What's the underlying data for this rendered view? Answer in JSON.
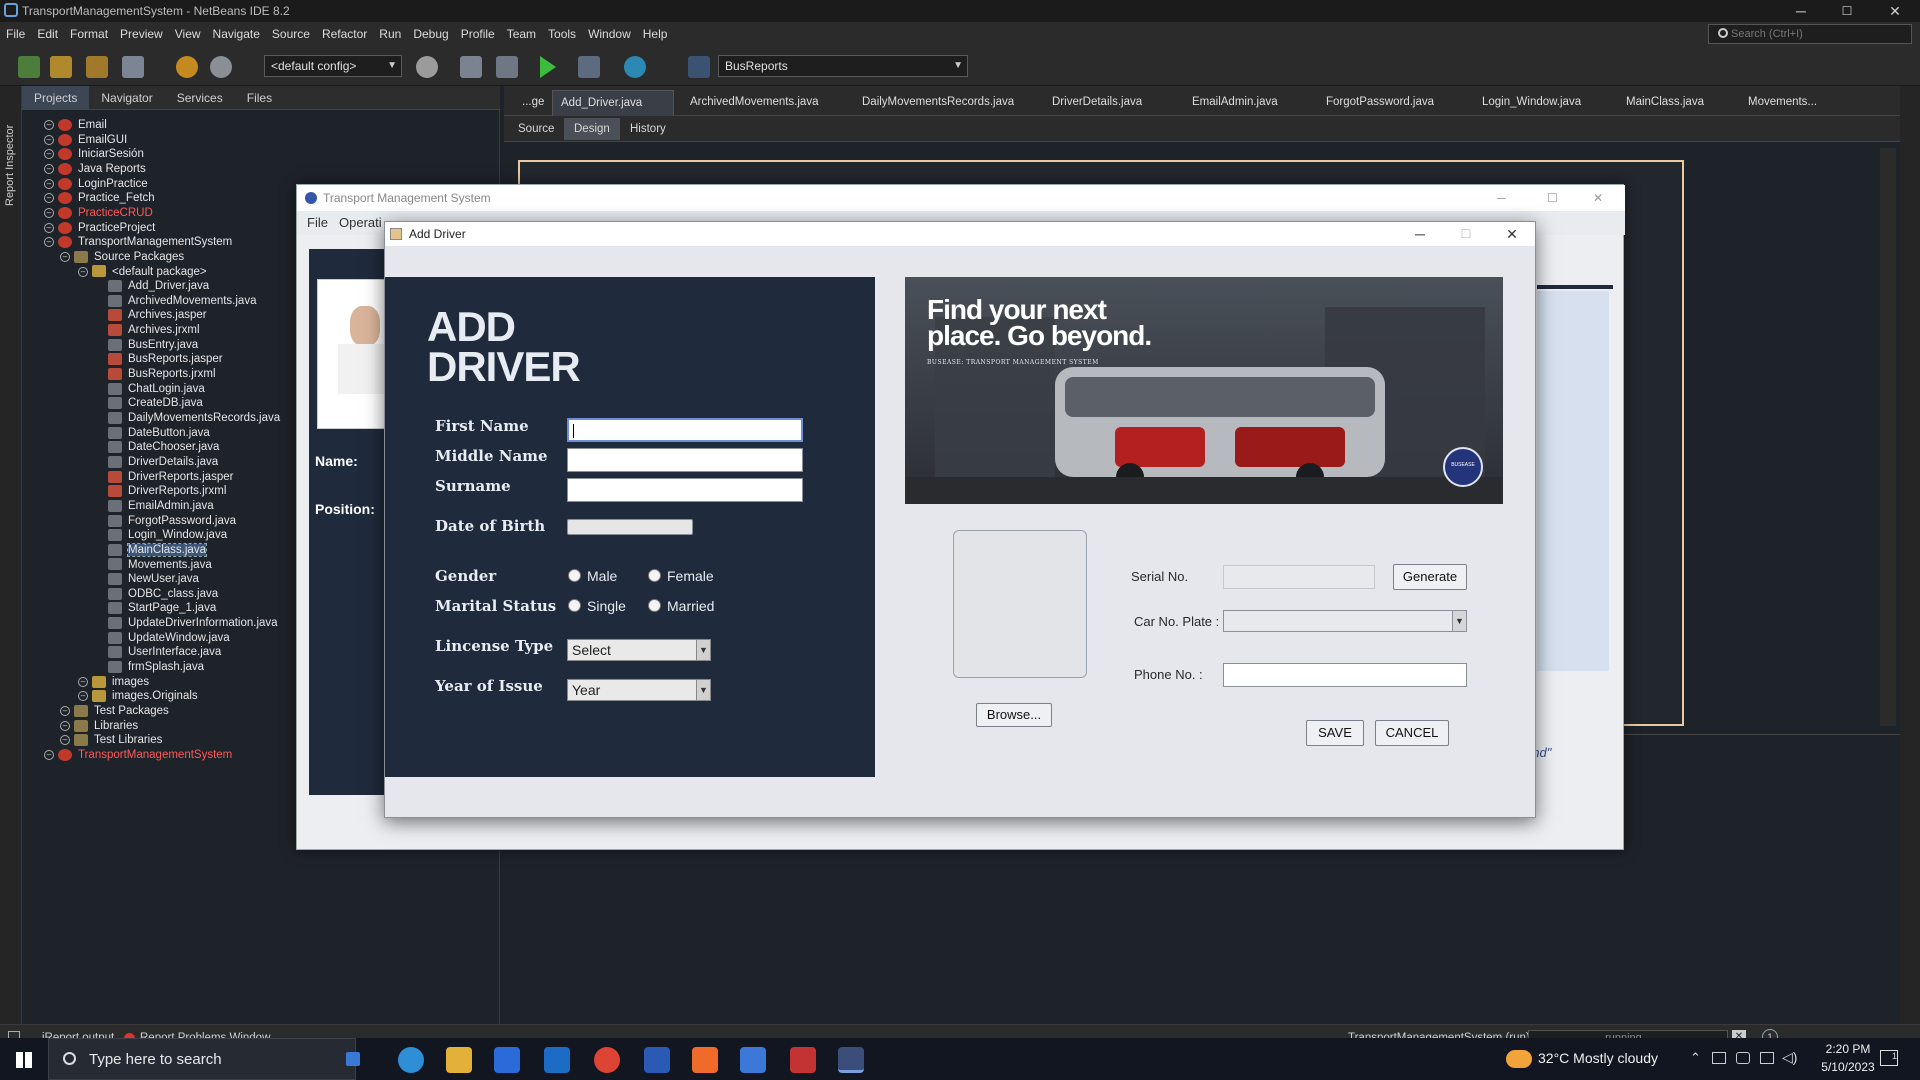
{
  "window": {
    "title": "TransportManagementSystem - NetBeans IDE 8.2",
    "minimize": "─",
    "maximize": "☐",
    "close": "✕"
  },
  "menu": [
    "File",
    "Edit",
    "Format",
    "Preview",
    "View",
    "Navigate",
    "Source",
    "Refactor",
    "Run",
    "Debug",
    "Profile",
    "Team",
    "Tools",
    "Window",
    "Help"
  ],
  "search_placeholder": "Search (Ctrl+I)",
  "toolbar": {
    "config": "<default config>",
    "report_combo": "BusReports"
  },
  "left_strip_label": "Report Inspector",
  "project_tabs": [
    "Projects",
    "Navigator",
    "Services",
    "Files"
  ],
  "tree": [
    {
      "label": "Email",
      "indent": 0,
      "type": "project",
      "red": false
    },
    {
      "label": "EmailGUI",
      "indent": 0,
      "type": "project",
      "red": false
    },
    {
      "label": "IniciarSesión",
      "indent": 0,
      "type": "project",
      "red": false
    },
    {
      "label": "Java Reports",
      "indent": 0,
      "type": "project",
      "red": false
    },
    {
      "label": "LoginPractice",
      "indent": 0,
      "type": "project",
      "red": false
    },
    {
      "label": "Practice_Fetch",
      "indent": 0,
      "type": "project",
      "red": false
    },
    {
      "label": "PracticeCRUD",
      "indent": 0,
      "type": "project",
      "red": true
    },
    {
      "label": "PracticeProject",
      "indent": 0,
      "type": "project",
      "red": false
    },
    {
      "label": "TransportManagementSystem",
      "indent": 0,
      "type": "project",
      "red": false
    },
    {
      "label": "Source Packages",
      "indent": 1,
      "type": "folder",
      "red": false
    },
    {
      "label": "<default package>",
      "indent": 2,
      "type": "package",
      "red": false
    },
    {
      "label": "Add_Driver.java",
      "indent": 3,
      "type": "java",
      "red": false
    },
    {
      "label": "ArchivedMovements.java",
      "indent": 3,
      "type": "java",
      "red": false
    },
    {
      "label": "Archives.jasper",
      "indent": 3,
      "type": "jasper",
      "red": false
    },
    {
      "label": "Archives.jrxml",
      "indent": 3,
      "type": "jrxml",
      "red": false
    },
    {
      "label": "BusEntry.java",
      "indent": 3,
      "type": "java",
      "red": false
    },
    {
      "label": "BusReports.jasper",
      "indent": 3,
      "type": "jasper",
      "red": false
    },
    {
      "label": "BusReports.jrxml",
      "indent": 3,
      "type": "jrxml",
      "red": false
    },
    {
      "label": "ChatLogin.java",
      "indent": 3,
      "type": "java",
      "red": false
    },
    {
      "label": "CreateDB.java",
      "indent": 3,
      "type": "java",
      "red": false
    },
    {
      "label": "DailyMovementsRecords.java",
      "indent": 3,
      "type": "java",
      "red": false
    },
    {
      "label": "DateButton.java",
      "indent": 3,
      "type": "java",
      "red": false
    },
    {
      "label": "DateChooser.java",
      "indent": 3,
      "type": "java",
      "red": false
    },
    {
      "label": "DriverDetails.java",
      "indent": 3,
      "type": "java",
      "red": false
    },
    {
      "label": "DriverReports.jasper",
      "indent": 3,
      "type": "jasper",
      "red": false
    },
    {
      "label": "DriverReports.jrxml",
      "indent": 3,
      "type": "jrxml",
      "red": false
    },
    {
      "label": "EmailAdmin.java",
      "indent": 3,
      "type": "java",
      "red": false
    },
    {
      "label": "ForgotPassword.java",
      "indent": 3,
      "type": "java",
      "red": false
    },
    {
      "label": "Login_Window.java",
      "indent": 3,
      "type": "java",
      "red": false
    },
    {
      "label": "MainClass.java",
      "indent": 3,
      "type": "java",
      "red": false,
      "selected": true
    },
    {
      "label": "Movements.java",
      "indent": 3,
      "type": "java",
      "red": false
    },
    {
      "label": "NewUser.java",
      "indent": 3,
      "type": "java",
      "red": false
    },
    {
      "label": "ODBC_class.java",
      "indent": 3,
      "type": "java",
      "red": false
    },
    {
      "label": "StartPage_1.java",
      "indent": 3,
      "type": "java",
      "red": false
    },
    {
      "label": "UpdateDriverInformation.java",
      "indent": 3,
      "type": "java",
      "red": false
    },
    {
      "label": "UpdateWindow.java",
      "indent": 3,
      "type": "java",
      "red": false
    },
    {
      "label": "UserInterface.java",
      "indent": 3,
      "type": "java",
      "red": false
    },
    {
      "label": "frmSplash.java",
      "indent": 3,
      "type": "java",
      "red": false
    },
    {
      "label": "images",
      "indent": 2,
      "type": "package",
      "red": false
    },
    {
      "label": "images.Originals",
      "indent": 2,
      "type": "package",
      "red": false
    },
    {
      "label": "Test Packages",
      "indent": 1,
      "type": "folder",
      "red": false
    },
    {
      "label": "Libraries",
      "indent": 1,
      "type": "folder",
      "red": false
    },
    {
      "label": "Test Libraries",
      "indent": 1,
      "type": "folder",
      "red": false
    },
    {
      "label": "TransportManagementSystem",
      "indent": 0,
      "type": "project",
      "red": true
    }
  ],
  "editor_tabs": [
    "...ge",
    "Add_Driver.java",
    "ArchivedMovements.java",
    "DailyMovementsRecords.java",
    "DriverDetails.java",
    "EmailAdmin.java",
    "ForgotPassword.java",
    "Login_Window.java",
    "MainClass.java",
    "Movements..."
  ],
  "editor_subtabs": [
    "Source",
    "Design",
    "History"
  ],
  "status": {
    "ireport": "iReport output",
    "problems": "Report Problems Window",
    "run": "TransportManagementSystem (run)",
    "running": "running..."
  },
  "tms": {
    "title": "Transport Management System",
    "menu": [
      "File",
      "Operati"
    ],
    "name_label": "Name:",
    "position_label": "Position:",
    "quote": "ond\""
  },
  "dialog": {
    "title": "Add Driver",
    "heading_line1": "ADD",
    "heading_line2": "DRIVER",
    "first_name": "First Name",
    "middle_name": "Middle Name",
    "surname": "Surname",
    "dob": "Date of Birth",
    "gender": "Gender",
    "male": "Male",
    "female": "Female",
    "marital": "Marital Status",
    "single": "Single",
    "married": "Married",
    "license": "Lincense Type",
    "license_value": "Select",
    "year_issue": "Year of Issue",
    "year_value": "Year",
    "banner_line1": "Find your next",
    "banner_line2": "place. Go beyond.",
    "banner_sub": "BUSEASE: TRANSPORT MANAGEMENT SYSTEM",
    "badge": "BUSEASE",
    "serial": "Serial No.",
    "generate": "Generate",
    "car_plate": "Car No. Plate :",
    "phone": "Phone No. :",
    "browse": "Browse...",
    "save": "SAVE",
    "cancel": "CANCEL"
  },
  "taskbar": {
    "search": "Type here to search",
    "weather": "32°C  Mostly cloudy",
    "time": "2:20 PM",
    "date": "5/10/2023",
    "notif": "1"
  }
}
